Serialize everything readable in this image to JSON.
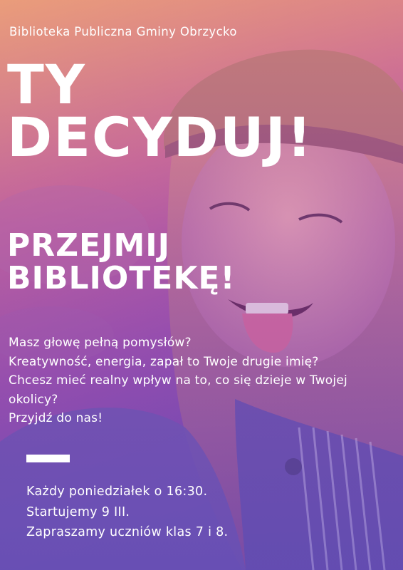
{
  "organization": "Biblioteka Publiczna Gminy Obrzycko",
  "headline": {
    "line1": "TY",
    "line2": "DECYDUJ!"
  },
  "subheadline": {
    "line1": "PRZEJMIJ",
    "line2": "BIBLIOTEKĘ!"
  },
  "body_lines": [
    "Masz głowę pełną pomysłów?",
    "Kreatywność, energia, zapał to Twoje drugie imię?",
    "Chcesz mieć realny wpływ na to, co się dzieje w Twojej okolicy?",
    "Przyjdź do nas!"
  ],
  "info_lines": [
    "Każdy poniedziałek o 16:30.",
    "Startujemy 9 III.",
    "Zapraszamy uczniów klas 7 i 8."
  ],
  "colors": {
    "text": "#ffffff",
    "gradient_top": "#e9a07c",
    "gradient_mid": "#9a4fae",
    "gradient_bottom": "#5a4ab8"
  }
}
